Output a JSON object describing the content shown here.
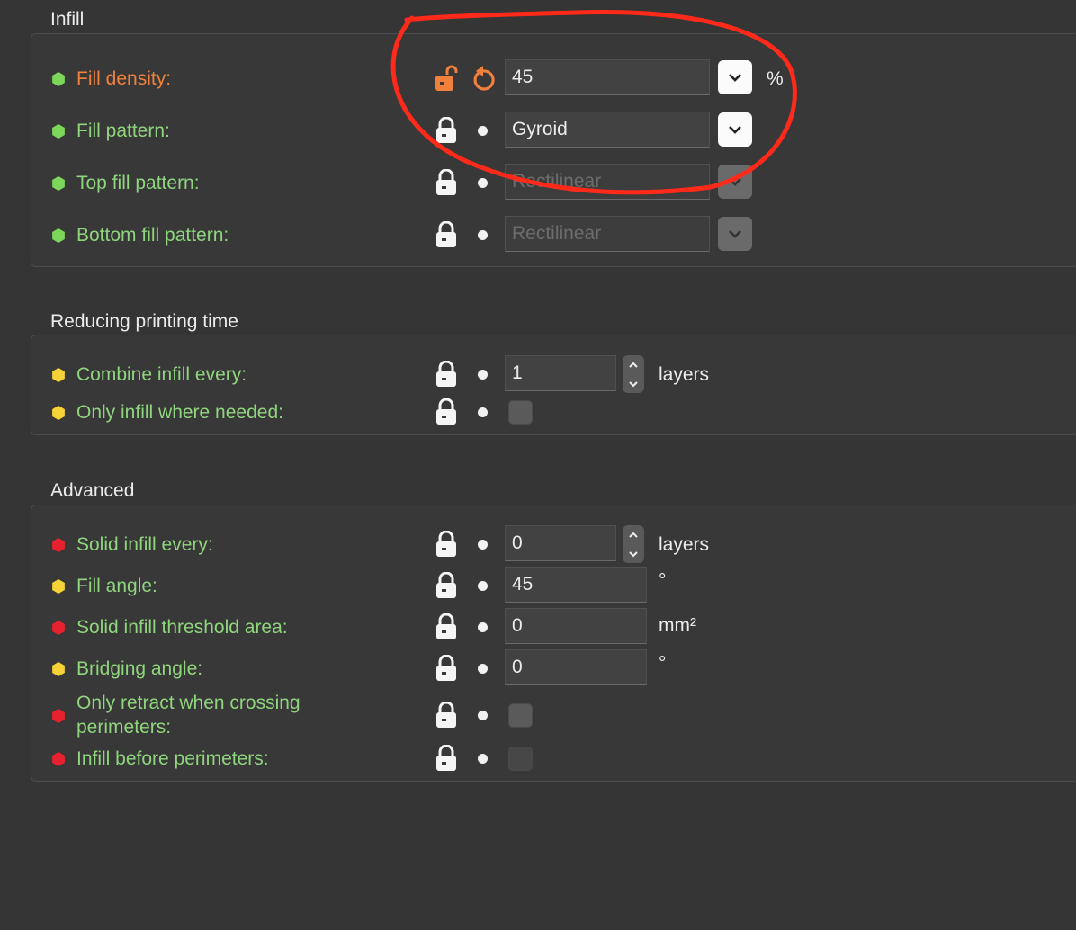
{
  "colors": {
    "green_bullet": "#7bd65a",
    "yellow_bullet": "#f5d235",
    "red_bullet": "#e8212f",
    "label_green": "#8fd57d",
    "label_modified": "#f0803c",
    "annotation": "#ff2a1a"
  },
  "infill": {
    "title": "Infill",
    "fill_density": {
      "label": "Fill density:",
      "value": "45",
      "unit": "%",
      "lock_icon": "unlocked-lock-icon",
      "reset_icon": "undo-arrow-icon"
    },
    "fill_pattern": {
      "label": "Fill pattern:",
      "value": "Gyroid"
    },
    "top_fill_pattern": {
      "label": "Top fill pattern:",
      "value": "Rectilinear"
    },
    "bottom_fill_pattern": {
      "label": "Bottom fill pattern:",
      "value": "Rectilinear"
    }
  },
  "reducing": {
    "title": "Reducing printing time",
    "combine_infill": {
      "label": "Combine infill every:",
      "value": "1",
      "unit": "layers"
    },
    "only_infill_needed": {
      "label": "Only infill where needed:",
      "checked": false
    }
  },
  "advanced": {
    "title": "Advanced",
    "solid_infill_every": {
      "label": "Solid infill every:",
      "value": "0",
      "unit": "layers"
    },
    "fill_angle": {
      "label": "Fill angle:",
      "value": "45",
      "unit": "°"
    },
    "solid_threshold": {
      "label": "Solid infill threshold area:",
      "value": "0",
      "unit": "mm²"
    },
    "bridging_angle": {
      "label": "Bridging angle:",
      "value": "0",
      "unit": "°"
    },
    "only_retract": {
      "label_line1": "Only retract when crossing",
      "label_line2": "perimeters:",
      "checked": false
    },
    "infill_before": {
      "label": "Infill before perimeters:",
      "checked": false
    }
  }
}
